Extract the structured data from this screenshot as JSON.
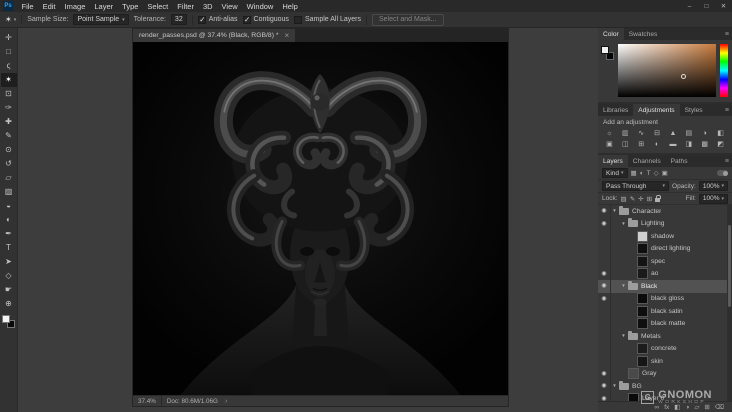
{
  "glyphs": {
    "caret": "▾",
    "eye": "◉",
    "menu": "≡",
    "chevron": "›",
    "tab_close": "×"
  },
  "colors": {
    "ui_background": "#3d3d3d",
    "panel_background": "#383838",
    "selected_row": "#525252",
    "hue_swatch": "#c87a3c",
    "canvas_background": "#000000"
  },
  "menubar": {
    "logo": "Ps",
    "items": [
      "File",
      "Edit",
      "Image",
      "Layer",
      "Type",
      "Select",
      "Filter",
      "3D",
      "View",
      "Window",
      "Help"
    ],
    "window_controls": [
      {
        "name": "minimize-button",
        "glyph": "–"
      },
      {
        "name": "maximize-button",
        "glyph": "□"
      },
      {
        "name": "close-button",
        "glyph": "✕"
      }
    ]
  },
  "options_bar": {
    "tool_icon": "✶",
    "sample_size_label": "Sample Size:",
    "sample_size_value": "Point Sample",
    "tolerance_label": "Tolerance:",
    "tolerance_value": "32",
    "checkboxes": [
      {
        "name": "anti-alias-checkbox",
        "label": "Anti-alias",
        "checked": true
      },
      {
        "name": "contiguous-checkbox",
        "label": "Contiguous",
        "checked": true
      },
      {
        "name": "sample-all-layers-checkbox",
        "label": "Sample All Layers",
        "checked": false
      }
    ],
    "select_mask_label": "Select and Mask..."
  },
  "toolbar": {
    "tools": [
      {
        "name": "move-tool",
        "glyph": "✛"
      },
      {
        "name": "marquee-tool",
        "glyph": "□"
      },
      {
        "name": "lasso-tool",
        "glyph": "ς"
      },
      {
        "name": "magic-wand-tool",
        "glyph": "✶",
        "active": true
      },
      {
        "name": "crop-tool",
        "glyph": "⊡"
      },
      {
        "name": "eyedropper-tool",
        "glyph": "✑"
      },
      {
        "name": "healing-brush-tool",
        "glyph": "✚"
      },
      {
        "name": "brush-tool",
        "glyph": "✎"
      },
      {
        "name": "clone-stamp-tool",
        "glyph": "⊙"
      },
      {
        "name": "history-brush-tool",
        "glyph": "↺"
      },
      {
        "name": "eraser-tool",
        "glyph": "▱"
      },
      {
        "name": "gradient-tool",
        "glyph": "▨"
      },
      {
        "name": "blur-tool",
        "glyph": "◒"
      },
      {
        "name": "dodge-tool",
        "glyph": "◐"
      },
      {
        "name": "pen-tool",
        "glyph": "✒"
      },
      {
        "name": "type-tool",
        "glyph": "T"
      },
      {
        "name": "path-selection-tool",
        "glyph": "➤"
      },
      {
        "name": "shape-tool",
        "glyph": "◇"
      },
      {
        "name": "hand-tool",
        "glyph": "☛"
      },
      {
        "name": "zoom-tool",
        "glyph": "⊕"
      }
    ]
  },
  "document": {
    "tab_title": "render_passes.psd @ 37.4% (Black, RGB/8) *",
    "status_zoom": "37.4%",
    "status_doc": "Doc: 80.6M/1.06G"
  },
  "color_panel": {
    "tabs": [
      {
        "name": "tab-color",
        "label": "Color",
        "active": true
      },
      {
        "name": "tab-swatches",
        "label": "Swatches",
        "active": false
      }
    ]
  },
  "adjustments_panel": {
    "tabs": [
      {
        "name": "tab-libraries",
        "label": "Libraries",
        "active": false
      },
      {
        "name": "tab-adjustments",
        "label": "Adjustments",
        "active": true
      },
      {
        "name": "tab-styles",
        "label": "Styles",
        "active": false
      }
    ],
    "header": "Add an adjustment",
    "icons": [
      {
        "name": "brightness-contrast-icon",
        "glyph": "☼"
      },
      {
        "name": "levels-icon",
        "glyph": "▥"
      },
      {
        "name": "curves-icon",
        "glyph": "∿"
      },
      {
        "name": "exposure-icon",
        "glyph": "⊟"
      },
      {
        "name": "vibrance-icon",
        "glyph": "▲"
      },
      {
        "name": "hue-saturation-icon",
        "glyph": "▤"
      },
      {
        "name": "color-balance-icon",
        "glyph": "◑"
      },
      {
        "name": "black-white-icon",
        "glyph": "◧"
      },
      {
        "name": "photo-filter-icon",
        "glyph": "▣"
      },
      {
        "name": "channel-mixer-icon",
        "glyph": "◫"
      },
      {
        "name": "color-lookup-icon",
        "glyph": "⊞"
      },
      {
        "name": "invert-icon",
        "glyph": "◐"
      },
      {
        "name": "posterize-icon",
        "glyph": "▬"
      },
      {
        "name": "threshold-icon",
        "glyph": "◨"
      },
      {
        "name": "gradient-map-icon",
        "glyph": "▩"
      },
      {
        "name": "selective-color-icon",
        "glyph": "◩"
      }
    ]
  },
  "layers_panel": {
    "tabs": [
      {
        "name": "tab-layers",
        "label": "Layers",
        "active": true
      },
      {
        "name": "tab-channels",
        "label": "Channels",
        "active": false
      },
      {
        "name": "tab-paths",
        "label": "Paths",
        "active": false
      }
    ],
    "filter_label": "Kind",
    "filter_icons": [
      {
        "name": "pixel-layer-filter-icon",
        "glyph": "▦"
      },
      {
        "name": "adjustment-layer-filter-icon",
        "glyph": "◐"
      },
      {
        "name": "type-layer-filter-icon",
        "glyph": "T"
      },
      {
        "name": "shape-layer-filter-icon",
        "glyph": "◇"
      },
      {
        "name": "smart-object-filter-icon",
        "glyph": "▣"
      }
    ],
    "blend_mode": "Pass Through",
    "opacity_label": "Opacity:",
    "opacity_value": "100%",
    "lock_label": "Lock:",
    "lock_icons": [
      {
        "name": "lock-transparency-icon",
        "glyph": "▨"
      },
      {
        "name": "lock-pixels-icon",
        "glyph": "✎"
      },
      {
        "name": "lock-position-icon",
        "glyph": "✛"
      },
      {
        "name": "lock-artboard-icon",
        "glyph": "⊞"
      }
    ],
    "lock_all_icon_name": "lock-all-icon",
    "fill_label": "Fill:",
    "fill_value": "100%",
    "layers": [
      {
        "name": "Character",
        "is_group": true,
        "expanded": true,
        "eye": true,
        "indent": 0
      },
      {
        "name": "Lighting",
        "is_group": true,
        "expanded": true,
        "eye": true,
        "indent": 1
      },
      {
        "name": "shadow",
        "eye": false,
        "indent": 2,
        "thumb": "#cfcfcf"
      },
      {
        "name": "direct lighting",
        "eye": false,
        "indent": 2,
        "thumb": "#101010"
      },
      {
        "name": "spec",
        "eye": false,
        "indent": 2,
        "thumb": "#141414"
      },
      {
        "name": "ao",
        "eye": true,
        "indent": 2,
        "thumb": "#1a1a1a"
      },
      {
        "name": "Black",
        "is_group": true,
        "expanded": true,
        "eye": true,
        "indent": 1,
        "selected": true
      },
      {
        "name": "black gloss",
        "eye": true,
        "indent": 2,
        "thumb": "#0b0b0b"
      },
      {
        "name": "black satin",
        "eye": false,
        "indent": 2,
        "thumb": "#0d0d0d"
      },
      {
        "name": "black matte",
        "eye": false,
        "indent": 2,
        "thumb": "#0f0f0f"
      },
      {
        "name": "Metals",
        "is_group": true,
        "expanded": true,
        "eye": false,
        "indent": 1
      },
      {
        "name": "concrete",
        "eye": false,
        "indent": 2,
        "thumb": "#1c1c1c"
      },
      {
        "name": "skin",
        "eye": false,
        "indent": 2,
        "thumb": "#161616"
      },
      {
        "name": "Gray",
        "eye": true,
        "indent": 1,
        "thumb": "#4a4a4a"
      },
      {
        "name": "BG",
        "is_group": true,
        "expanded": true,
        "eye": true,
        "indent": 0
      },
      {
        "name": "Layer 0",
        "eye": true,
        "indent": 1,
        "thumb": "#0a0a0a"
      }
    ],
    "footer_icons": [
      {
        "name": "link-layers-icon",
        "glyph": "∞"
      },
      {
        "name": "layer-style-icon",
        "glyph": "fx"
      },
      {
        "name": "add-mask-icon",
        "glyph": "◧"
      },
      {
        "name": "new-adjustment-layer-icon",
        "glyph": "◑"
      },
      {
        "name": "new-group-icon",
        "glyph": "▱"
      },
      {
        "name": "new-layer-icon",
        "glyph": "⊞"
      },
      {
        "name": "delete-layer-icon",
        "glyph": "⌫"
      }
    ]
  },
  "watermark": {
    "logo_letter": "G",
    "line1": "GNOMON",
    "line2": "WORKSHOP"
  }
}
